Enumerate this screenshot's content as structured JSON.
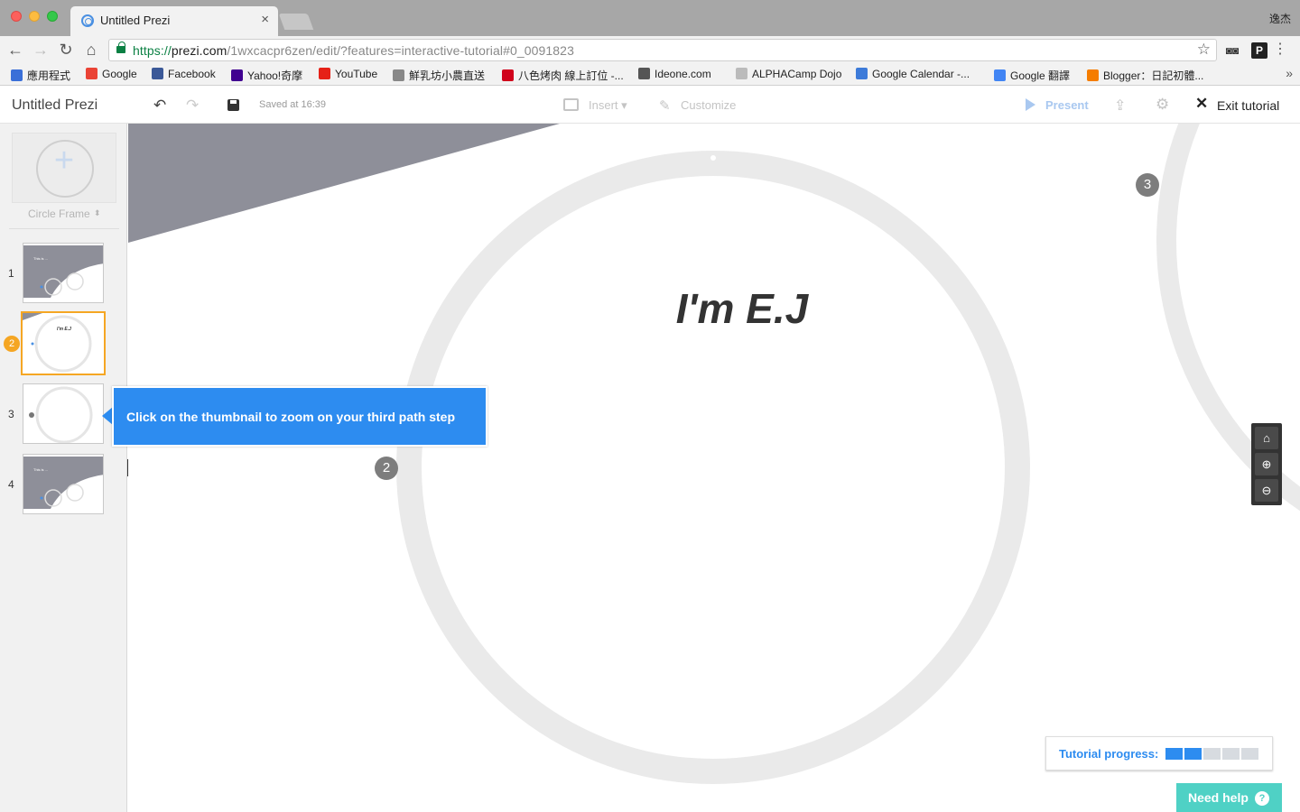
{
  "browser": {
    "tab_title": "Untitled Prezi",
    "tab_close": "×",
    "profile_name": "逸杰",
    "url_scheme": "https://",
    "url_host": "prezi.com",
    "url_path": "/1wxcacpr6zen/edit/?features=interactive-tutorial#0_0091823",
    "nav_back": "←",
    "nav_forward": "→",
    "nav_reload": "↻",
    "nav_home": "⌂",
    "star": "☆",
    "menu": "⋮",
    "ext_p": "P",
    "ext_mask": "◙◙"
  },
  "bookmarks": [
    {
      "label": "應用程式",
      "icon": "apps-icon",
      "color": "#3a6fd8"
    },
    {
      "label": "Google",
      "icon": "google-icon",
      "color": "#ea4335"
    },
    {
      "label": "Facebook",
      "icon": "facebook-icon",
      "color": "#3b5998"
    },
    {
      "label": "Yahoo!奇摩",
      "icon": "yahoo-icon",
      "color": "#400090"
    },
    {
      "label": "YouTube",
      "icon": "youtube-icon",
      "color": "#e62117"
    },
    {
      "label": "鮮乳坊小農直送",
      "icon": "cloud-icon",
      "color": "#888888"
    },
    {
      "label": "八色烤肉 線上訂位 -...",
      "icon": "restaurant-icon",
      "color": "#d0021b"
    },
    {
      "label": "Ideone.com",
      "icon": "ideone-icon",
      "color": "#555555"
    },
    {
      "label": "ALPHACamp Dojo",
      "icon": "page-icon",
      "color": "#bbbbbb"
    },
    {
      "label": "Google Calendar -...",
      "icon": "calendar-icon",
      "color": "#3d7bd9"
    },
    {
      "label": "Google 翻譯",
      "icon": "translate-icon",
      "color": "#4285f4"
    },
    {
      "label": "Blogger：日記初體...",
      "icon": "blogger-icon",
      "color": "#f57d00"
    }
  ],
  "bookmarks_more": "»",
  "header": {
    "title": "Untitled Prezi",
    "undo": "↶",
    "redo": "↷",
    "saved_text": "Saved at 16:39",
    "insert_label": "Insert ▾",
    "customize_label": "Customize",
    "present_label": "Present",
    "share": "⇪",
    "gear": "⚙",
    "exit_icon": "✕",
    "exit_label": "Exit tutorial"
  },
  "sidebar": {
    "add_plus": "+",
    "frame_type": "Circle Frame",
    "frame_type_arrow": "⬍",
    "steps": [
      {
        "num": "1"
      },
      {
        "num": "2",
        "active": true
      },
      {
        "num": "3"
      },
      {
        "num": "4"
      }
    ],
    "thumb_title_1": "This is ...",
    "thumb_title_2": "I'm E.J",
    "collapse": "||"
  },
  "canvas": {
    "title": "I'm E.J",
    "marker_2": "2",
    "marker_3": "3",
    "colors": {
      "bg_shape": "#8e8f99",
      "ring": "#eaeaea"
    }
  },
  "tooltip": {
    "text": "Click on the thumbnail to zoom on your third path step"
  },
  "zoom": {
    "home": "⌂",
    "zoom_in": "⊕",
    "zoom_out": "⊖"
  },
  "progress": {
    "label": "Tutorial progress:",
    "completed": 2,
    "total": 5
  },
  "help": {
    "label": "Need help",
    "icon": "?"
  }
}
